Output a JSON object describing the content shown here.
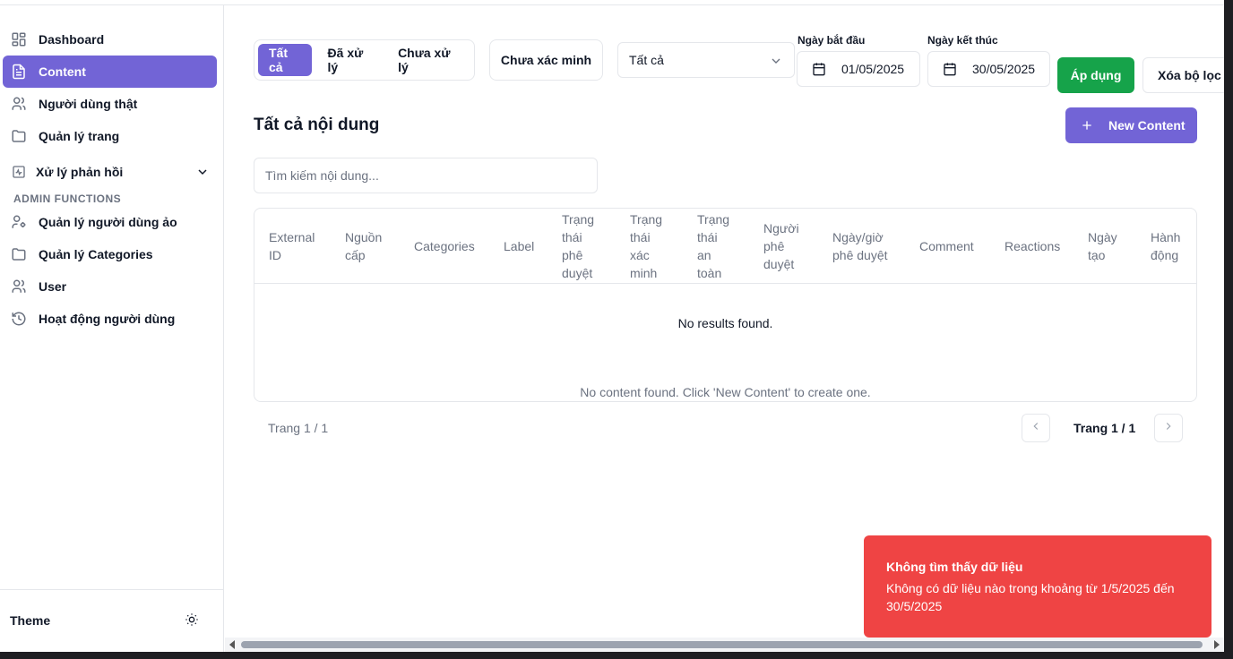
{
  "sidebar": {
    "items": [
      {
        "label": "Dashboard",
        "icon": "dashboard-icon"
      },
      {
        "label": "Content",
        "icon": "file-icon",
        "active": true
      },
      {
        "label": "Người dùng thật",
        "icon": "users-icon"
      },
      {
        "label": "Quản lý trang",
        "icon": "folder-icon"
      },
      {
        "label": "Xử lý phản hồi",
        "icon": "activity-icon"
      }
    ],
    "section_label": "ADMIN FUNCTIONS",
    "admin_items": [
      {
        "label": "Quản lý người dùng ảo",
        "icon": "user-cog-icon"
      },
      {
        "label": "Quản lý Categories",
        "icon": "folder-icon"
      },
      {
        "label": "User",
        "icon": "users-icon"
      },
      {
        "label": "Hoạt động người dùng",
        "icon": "history-icon"
      }
    ],
    "theme_label": "Theme"
  },
  "filters": {
    "segments": [
      "Tất cả",
      "Đã xử lý",
      "Chưa xử lý"
    ],
    "unverified_label": "Chưa xác minh",
    "select_value": "Tất cả",
    "start_label": "Ngày bắt đầu",
    "start_value": "01/05/2025",
    "end_label": "Ngày kết thúc",
    "end_value": "30/05/2025",
    "apply_label": "Áp dụng",
    "clear_label": "Xóa bộ lọc"
  },
  "content": {
    "title": "Tất cả nội dung",
    "new_button": "New Content",
    "search_placeholder": "Tìm kiếm nội dung...",
    "columns": [
      "External ID",
      "Nguồn cấp",
      "Categories",
      "Label",
      "Trạng thái phê duyệt",
      "Trạng thái xác minh",
      "Trạng thái an toàn",
      "Người phê duyệt",
      "Ngày/giờ phê duyệt",
      "Comment",
      "Reactions",
      "Ngày tạo",
      "Hành động"
    ],
    "empty_text": "No results found.",
    "empty_hint": "No content found. Click 'New Content' to create one."
  },
  "pagination": {
    "summary": "Trang 1 / 1",
    "current": "Trang 1 / 1"
  },
  "toast": {
    "title": "Không tìm thấy dữ liệu",
    "message": "Không có dữ liệu nào trong khoảng từ 1/5/2025 đến 30/5/2025"
  },
  "colors": {
    "accent": "#7264d6",
    "success": "#16a34a",
    "danger": "#ef4444"
  }
}
